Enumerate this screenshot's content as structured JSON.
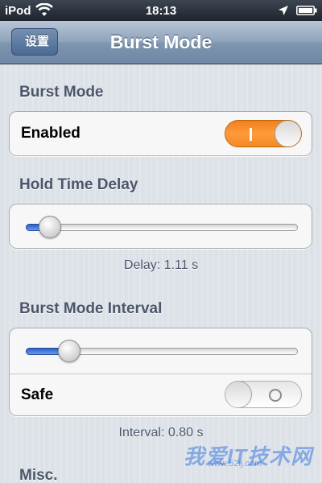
{
  "status": {
    "carrier": "iPod",
    "time": "18:13",
    "icons": [
      "wifi-icon",
      "location-icon",
      "battery-icon"
    ]
  },
  "nav": {
    "back_label": "设置",
    "title": "Burst Mode"
  },
  "sections": {
    "burst_mode": {
      "header": "Burst Mode",
      "enabled_label": "Enabled",
      "enabled_value": true
    },
    "hold_delay": {
      "header": "Hold Time Delay",
      "slider_fraction": 0.09,
      "footer": "Delay: 1.11 s"
    },
    "interval": {
      "header": "Burst Mode Interval",
      "slider_fraction": 0.16,
      "safe_label": "Safe",
      "safe_value": false,
      "footer": "Interval: 0.80 s"
    },
    "misc": {
      "header": "Misc."
    }
  },
  "watermark": {
    "text": "我爱IT技术网",
    "url": "www.52ij.com"
  },
  "colors": {
    "switch_on": "#f48a25",
    "slider_fill": "#2a5fc8",
    "section_header": "#4c566a"
  }
}
